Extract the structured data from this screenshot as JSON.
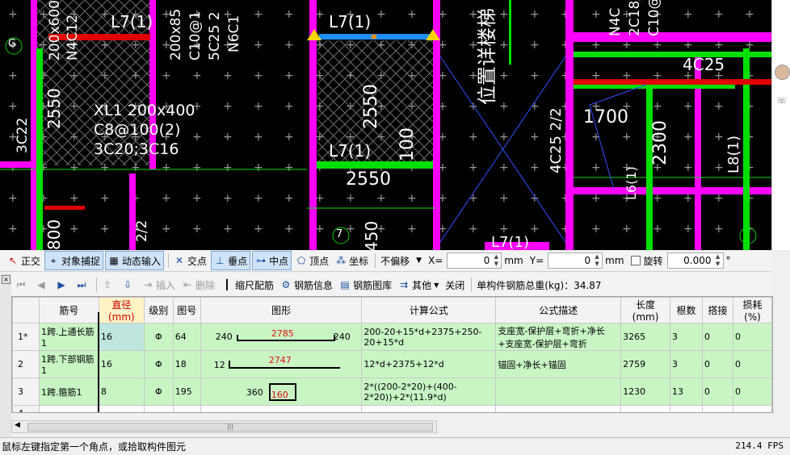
{
  "cad": {
    "labels": {
      "l1": "L7(1)",
      "l2": "L7(1)",
      "l3": "L7(1)",
      "l4": "L7(1)",
      "dim1": "2550",
      "dim2": "2550",
      "dim3": "2550",
      "dim4": "1700",
      "dim5": "2300",
      "dim6": "800",
      "dim7": "100",
      "beam_xl1": "XL1 200x400",
      "beam_xl1_stirrup": "C8@100(2)",
      "beam_xl1_bars": "3C20;3C16",
      "note_pos": "位置详楼梯",
      "bar1": "4C25 2/2",
      "bar2": "4C25",
      "lbl_l6": "L6(1)",
      "lbl_l8": "L8(1)",
      "v1": "200x600",
      "v2": "N4C12",
      "v3": "200x85",
      "v4": "C10@1",
      "v5": "5C25 2",
      "v6": "N6C1",
      "axis_g": "G",
      "axis_7": "7",
      "sec1": "3C22",
      "sec2": "2/2",
      "sec3": "450",
      "v7": "N4C",
      "v8": "2C18/",
      "v9": "C10@"
    }
  },
  "toolbar1": {
    "items": [
      {
        "label": "正交",
        "icon": "orthogonal-icon"
      },
      {
        "label": "对象捕捉",
        "icon": "object-snap-icon",
        "active": true
      },
      {
        "label": "动态输入",
        "icon": "dynamic-input-icon",
        "active": true
      },
      {
        "label": "交点",
        "icon": "intersection-icon"
      },
      {
        "label": "垂点",
        "icon": "perpendicular-icon",
        "active": true
      },
      {
        "label": "中点",
        "icon": "midpoint-icon",
        "active": true
      },
      {
        "label": "顶点",
        "icon": "vertex-icon"
      },
      {
        "label": "坐标",
        "icon": "coordinate-icon"
      }
    ],
    "offset_select": "不偏移",
    "x_label": "X=",
    "x_value": "0",
    "x_unit": "mm",
    "y_label": "Y=",
    "y_value": "0",
    "y_unit": "mm",
    "rotate_label": "旋转",
    "rotate_value": "0.000",
    "rotate_unit": "°"
  },
  "toolbar2": {
    "insert": "插入",
    "delete": "删除",
    "scale_rebar": "缩尺配筋",
    "rebar_info": "钢筋信息",
    "rebar_lib": "钢筋图库",
    "other": "其他",
    "close": "关闭",
    "total_weight": "单构件钢筋总重(kg)：34.87"
  },
  "grid": {
    "headers": [
      "筋号",
      "直径(mm)",
      "级别",
      "图号",
      "图形",
      "计算公式",
      "公式描述",
      "长度(mm)",
      "根数",
      "搭接",
      "损耗(%)"
    ],
    "rows": [
      {
        "idx": "1*",
        "name": "1跨.上通长筋1",
        "dia": "16",
        "grade": "Φ",
        "fig": "64",
        "shape_left": "240",
        "shape_mid": "2785",
        "shape_right": "240",
        "formula": "200-20+15*d+2375+250-20+15*d",
        "desc": "支座宽-保护层+弯折+净长+支座宽-保护层+弯折",
        "length": "3265",
        "count": "3",
        "lap": "0",
        "loss": "0"
      },
      {
        "idx": "2",
        "name": "1跨.下部钢筋1",
        "dia": "16",
        "grade": "Φ",
        "fig": "18",
        "shape_left": "12",
        "shape_mid": "2747",
        "shape_right": "",
        "formula": "12*d+2375+12*d",
        "desc": "锚固+净长+锚固",
        "length": "2759",
        "count": "3",
        "lap": "0",
        "loss": "0"
      },
      {
        "idx": "3",
        "name": "1跨.箍筋1",
        "dia": "8",
        "grade": "Φ",
        "fig": "195",
        "shape_left": "360",
        "shape_mid": "160",
        "shape_right": "",
        "formula": "2*((200-2*20)+(400-2*20))+2*(11.9*d)",
        "desc": "",
        "length": "1230",
        "count": "13",
        "lap": "0",
        "loss": "0"
      },
      {
        "idx": "4",
        "name": "",
        "dia": "",
        "grade": "",
        "fig": "",
        "shape_left": "",
        "shape_mid": "",
        "shape_right": "",
        "formula": "",
        "desc": "",
        "length": "",
        "count": "",
        "lap": "",
        "loss": ""
      }
    ]
  },
  "status": {
    "message": "鼠标左键指定第一个角点，或拾取构件图元",
    "fps": "214.4 FPS"
  }
}
